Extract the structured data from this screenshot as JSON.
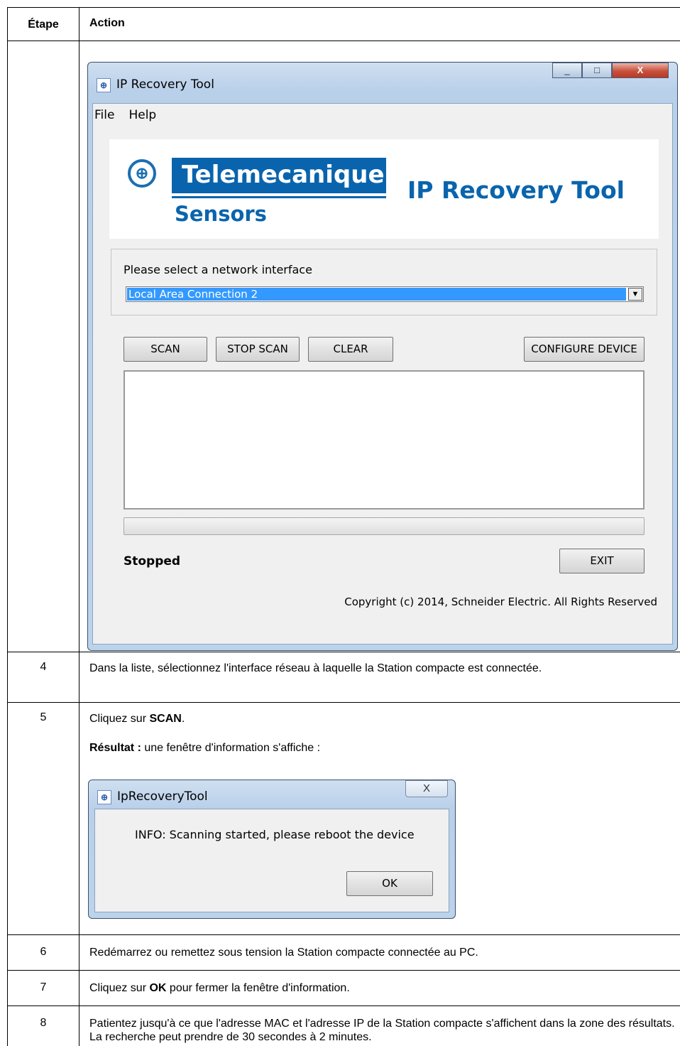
{
  "table": {
    "header": {
      "step": "Étape",
      "action": "Action"
    },
    "rows": [
      {
        "step": "4",
        "text": "Dans la liste, sélectionnez l'interface réseau à laquelle la Station compacte est connectée."
      },
      {
        "step": "5",
        "line1_pre": "Cliquez sur ",
        "line1_bold": "SCAN",
        "line1_post": ".",
        "line2_bold": "Résultat :",
        "line2_post": " une fenêtre d'information s'affiche :"
      },
      {
        "step": "6",
        "text": "Redémarrez ou remettez sous tension la Station compacte connectée au PC."
      },
      {
        "step": "7",
        "pre": "Cliquez sur ",
        "bold": "OK",
        "post": " pour fermer la fenêtre d'information."
      },
      {
        "step": "8",
        "text": "Patientez jusqu'à ce que l'adresse MAC et l'adresse IP de la Station compacte s'affichent dans la zone des résultats. La recherche peut prendre de 30 secondes à 2 minutes."
      }
    ]
  },
  "main_window": {
    "title": "IP Recovery Tool",
    "controls": {
      "minimize": "_",
      "maximize": "□",
      "close": "X"
    },
    "menu": [
      "File",
      "Help"
    ],
    "banner": {
      "brand": "Telemecanique",
      "sub": "Sensors",
      "product": "IP Recovery Tool"
    },
    "interface_label": "Please select a network interface",
    "interface_value": "Local Area Connection 2",
    "buttons": {
      "scan": "SCAN",
      "stop_scan": "STOP SCAN",
      "clear": "CLEAR",
      "configure": "CONFIGURE DEVICE",
      "exit": "EXIT"
    },
    "progress": 0,
    "status": "Stopped",
    "copyright": "Copyright (c) 2014, Schneider Electric. All Rights Reserved"
  },
  "info_dialog": {
    "title": "IpRecoveryTool",
    "close": "X",
    "message": "INFO: Scanning started, please reboot the device",
    "ok": "OK"
  },
  "colors": {
    "brand_blue": "#0a64ad",
    "selection": "#3399ff"
  }
}
